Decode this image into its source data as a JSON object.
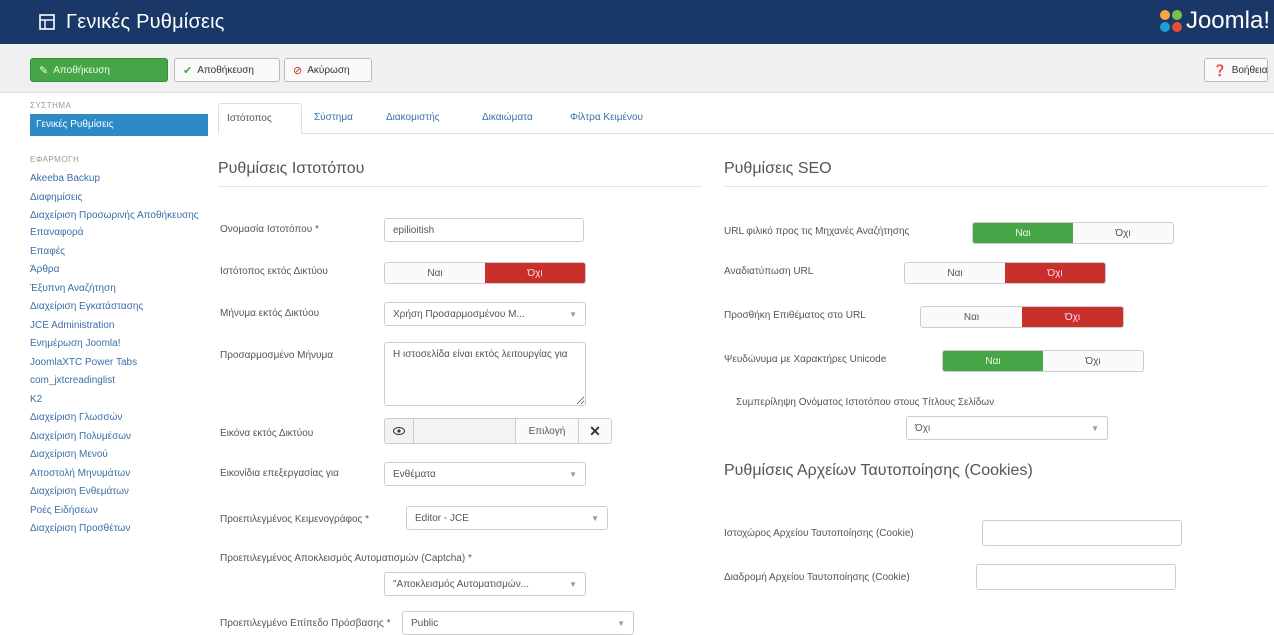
{
  "header": {
    "title": "Γενικές Ρυθμίσεις",
    "logo_text": "Joomla!"
  },
  "toolbar": {
    "save": "Αποθήκευση",
    "save_close": "Αποθήκευση",
    "cancel": "Ακύρωση",
    "help": "Βοήθεια"
  },
  "sidebar": {
    "system_heading": "ΣΥΣΤΗΜΑ",
    "active_item": "Γενικές Ρυθμίσεις",
    "components_heading": "ΕΦΑΡΜΟΓΗ",
    "items": [
      "Akeeba Backup",
      "Διαφημίσεις",
      "Διαχείριση Προσωρινής Αποθήκευσης",
      "Επαναφορά",
      "Επαφές",
      "Άρθρα",
      "Έξυπνη Αναζήτηση",
      "Διαχείριση Εγκατάστασης",
      "JCE Administration",
      "Ενημέρωση Joomla!",
      "JoomlaXTC Power Tabs",
      "com_jxtcreadinglist",
      "K2",
      "Διαχείριση Γλωσσών",
      "Διαχείριση Πολυμέσων",
      "Διαχείριση Μενού",
      "Αποστολή Μηνυμάτων",
      "Διαχείριση Ενθεμάτων",
      "Ροές Ειδήσεων",
      "Διαχείριση Προσθέτων"
    ]
  },
  "tabs": [
    "Ιστότοπος",
    "Σύστημα",
    "Διακομιστής",
    "Δικαιώματα",
    "Φίλτρα Κειμένου"
  ],
  "site": {
    "heading": "Ρυθμίσεις Ιστοτόπου",
    "site_name_label": "Ονομασία Ιστοτόπου *",
    "site_name_value": "epilioitish",
    "offline_label": "Ιστότοπος εκτός Δικτύου",
    "offline_yes": "Ναι",
    "offline_no": "Όχι",
    "offline_msg_label": "Μήνυμα εκτός Δικτύου",
    "offline_msg_value": "Χρήση Προσαρμοσμένου Μ...",
    "custom_msg_label": "Προσαρμοσμένο Μήνυμα",
    "custom_msg_value": "Η ιστοσελίδα είναι εκτός λειτουργίας για",
    "offline_image_label": "Εικόνα εκτός Δικτύου",
    "offline_image_select": "Επιλογή",
    "icons_label": "Εικονίδια επεξεργασίας για",
    "icons_value": "Ενθέματα",
    "editor_label": "Προεπιλεγμένος Κειμενογράφος *",
    "editor_value": "Editor - JCE",
    "captcha_label": "Προεπιλεγμένος Αποκλεισμός Αυτοματισμών (Captcha) *",
    "captcha_value": "\"Αποκλεισμός Αυτοματισμών...",
    "access_label": "Προεπιλεγμένο Επίπεδο Πρόσβασης *",
    "access_value": "Public"
  },
  "seo": {
    "heading": "Ρυθμίσεις SEO",
    "sef_label": "URL φιλικό προς τις Μηχανές Αναζήτησης",
    "rewrite_label": "Αναδιατύπωση URL",
    "suffix_label": "Προσθήκη Επιθέματος στο URL",
    "unicode_label": "Ψευδώνυμα με Χαρακτήρες Unicode",
    "sitename_label": "Συμπερίληψη Ονόματος Ιστοτόπου στους Τίτλους Σελίδων",
    "sitename_value": "Όχι",
    "yes": "Ναι",
    "no": "Όχι"
  },
  "cookies": {
    "heading": "Ρυθμίσεις Αρχείων Ταυτοποίησης (Cookies)",
    "domain_label": "Ιστοχώρος Αρχείου Ταυτοποίησης (Cookie)",
    "path_label": "Διαδρομή Αρχείου Ταυτοποίησης (Cookie)"
  },
  "colors": {
    "header": "#1a3867",
    "green": "#46a546",
    "red": "#c9302c",
    "link": "#3a6fa8",
    "active": "#2d8ac7"
  }
}
